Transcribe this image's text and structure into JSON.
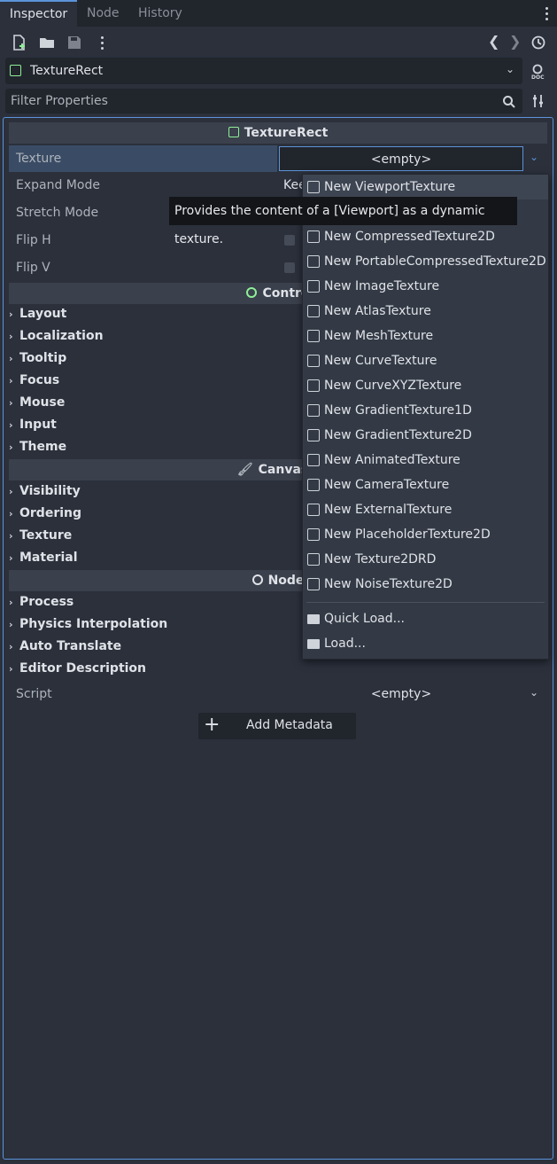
{
  "tabs": [
    "Inspector",
    "Node",
    "History"
  ],
  "node_selector": {
    "name": "TextureRect"
  },
  "filter": {
    "placeholder": "Filter Properties"
  },
  "section_texturerect": "TextureRect",
  "properties": {
    "texture": {
      "label": "Texture",
      "value": "<empty>"
    },
    "expand_mode": {
      "label": "Expand Mode",
      "value": "Kee"
    },
    "stretch_mode": {
      "label": "Stretch Mode"
    },
    "flip_h": {
      "label": "Flip H"
    },
    "flip_v": {
      "label": "Flip V"
    }
  },
  "section_control": "Contro",
  "control_groups": [
    "Layout",
    "Localization",
    "Tooltip",
    "Focus",
    "Mouse",
    "Input",
    "Theme"
  ],
  "section_canvasitem": "CanvasIt",
  "canvasitem_groups": [
    "Visibility",
    "Ordering",
    "Texture",
    "Material"
  ],
  "section_node": "Node",
  "node_groups": [
    "Process",
    "Physics Interpolation",
    "Auto Translate",
    "Editor Description"
  ],
  "script": {
    "label": "Script",
    "value": "<empty>"
  },
  "add_metadata": "Add Metadata",
  "dropdown_items": [
    "New ViewportTexture",
    "New CompressedTexture2D",
    "New PortableCompressedTexture2D",
    "New ImageTexture",
    "New AtlasTexture",
    "New MeshTexture",
    "New CurveTexture",
    "New CurveXYZTexture",
    "New GradientTexture1D",
    "New GradientTexture2D",
    "New AnimatedTexture",
    "New CameraTexture",
    "New ExternalTexture",
    "New PlaceholderTexture2D",
    "New Texture2DRD",
    "New NoiseTexture2D"
  ],
  "dropdown_load_items": [
    "Quick Load...",
    "Load..."
  ],
  "tooltip": "Provides the content of a [Viewport] as a dynamic texture.",
  "colors": {
    "accent": "#5c93d9",
    "panel": "#2b303b",
    "node_icon": "#8eef97"
  }
}
